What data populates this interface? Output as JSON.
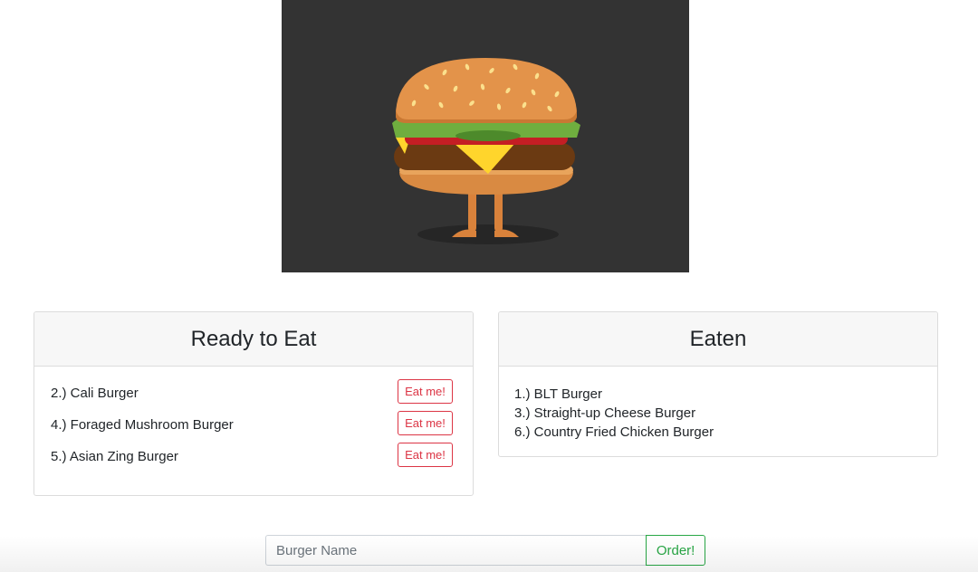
{
  "hero": {
    "icon": "burger-mascot-icon",
    "background": "#333333"
  },
  "ready": {
    "title": "Ready to Eat",
    "items": [
      {
        "label": "2.) Cali Burger",
        "button": "Eat me!"
      },
      {
        "label": "4.) Foraged Mushroom Burger",
        "button": "Eat me!"
      },
      {
        "label": "5.) Asian Zing Burger",
        "button": "Eat me!"
      }
    ]
  },
  "eaten": {
    "title": "Eaten",
    "items": [
      "1.) BLT Burger",
      "3.) Straight-up Cheese Burger",
      "6.) Country Fried Chicken Burger"
    ]
  },
  "order": {
    "placeholder": "Burger Name",
    "value": "",
    "button": "Order!"
  },
  "colors": {
    "danger": "#dc3545",
    "success": "#28a745"
  }
}
